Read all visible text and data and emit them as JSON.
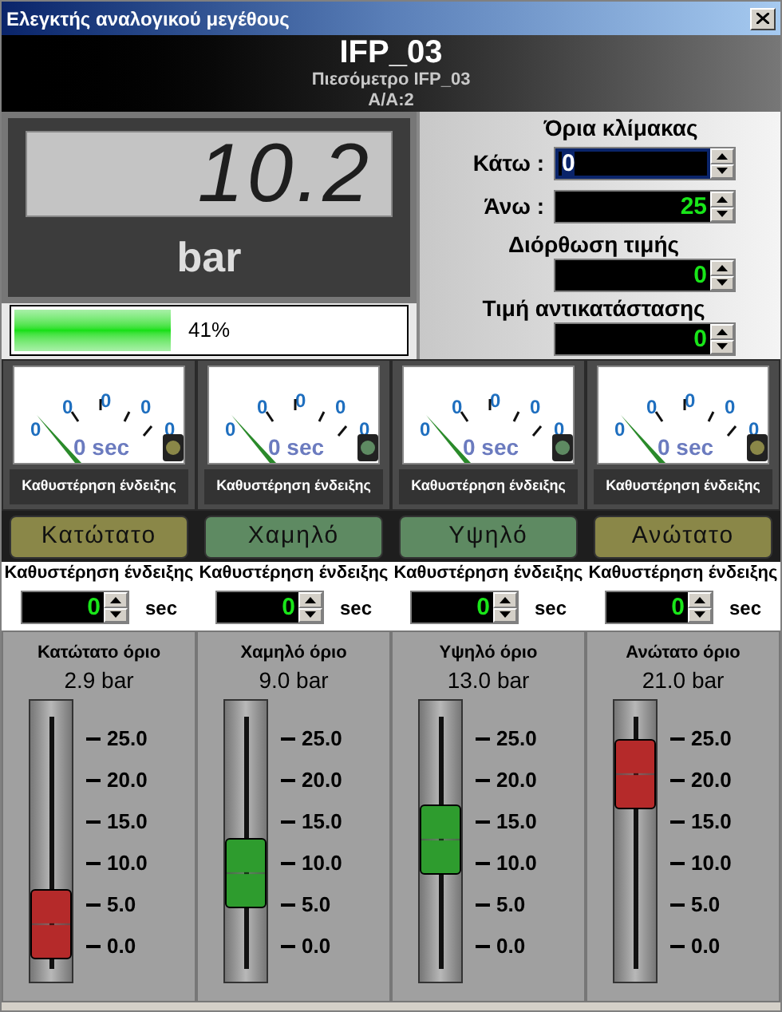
{
  "window": {
    "title": "Ελεγκτής αναλογικού μεγέθους"
  },
  "header": {
    "tag": "IFP_03",
    "description": "Πιεσόμετρο IFP_03",
    "index": "A/A:2"
  },
  "display": {
    "value": "10.2",
    "unit": "bar"
  },
  "progress": {
    "level": 0.41,
    "reading": "41%"
  },
  "scale": {
    "title": "Όρια κλίμακας",
    "fields": [
      {
        "kind": "inline",
        "label": "Κάτω :",
        "value": "0",
        "focused": true
      },
      {
        "kind": "inline",
        "label": "Άνω :",
        "value": "25",
        "focused": false
      },
      {
        "kind": "titled",
        "label": "Διόρθωση τιμής",
        "value": "0",
        "focused": false
      },
      {
        "kind": "titled",
        "label": "Τιμή αντικατάστασης",
        "value": "0",
        "focused": false
      }
    ]
  },
  "channels": [
    {
      "gauge": {
        "labels": [
          "0",
          "0",
          "0",
          "0",
          "0"
        ],
        "reading": "0 sec",
        "caption": "Καθυστέρηση ένδειξης"
      },
      "alarm": {
        "label": "Κατώτατο",
        "color": "#8a8748"
      },
      "delay": {
        "label": "Καθυστέρηση ένδειξης",
        "value": "0",
        "unit": "sec"
      },
      "limit": {
        "title": "Κατώτατο όριο",
        "reading": "2.9 bar",
        "level": 0.116,
        "color": "#b52a2a",
        "ticks": [
          "25.0",
          "20.0",
          "15.0",
          "10.0",
          "5.0",
          "0.0"
        ]
      }
    },
    {
      "gauge": {
        "labels": [
          "0",
          "0",
          "0",
          "0",
          "0"
        ],
        "reading": "0 sec",
        "caption": "Καθυστέρηση ένδειξης"
      },
      "alarm": {
        "label": "Χαμηλό",
        "color": "#5e8a62"
      },
      "delay": {
        "label": "Καθυστέρηση ένδειξης",
        "value": "0",
        "unit": "sec"
      },
      "limit": {
        "title": "Χαμηλό όριο",
        "reading": "9.0 bar",
        "level": 0.36,
        "color": "#2e9c2e",
        "ticks": [
          "25.0",
          "20.0",
          "15.0",
          "10.0",
          "5.0",
          "0.0"
        ]
      }
    },
    {
      "gauge": {
        "labels": [
          "0",
          "0",
          "0",
          "0",
          "0"
        ],
        "reading": "0 sec",
        "caption": "Καθυστέρηση ένδειξης"
      },
      "alarm": {
        "label": "Υψηλό",
        "color": "#5e8a62"
      },
      "delay": {
        "label": "Καθυστέρηση ένδειξης",
        "value": "0",
        "unit": "sec"
      },
      "limit": {
        "title": "Υψηλό όριο",
        "reading": "13.0 bar",
        "level": 0.52,
        "color": "#2e9c2e",
        "ticks": [
          "25.0",
          "20.0",
          "15.0",
          "10.0",
          "5.0",
          "0.0"
        ]
      }
    },
    {
      "gauge": {
        "labels": [
          "0",
          "0",
          "0",
          "0",
          "0"
        ],
        "reading": "0 sec",
        "caption": "Καθυστέρηση ένδειξης"
      },
      "alarm": {
        "label": "Ανώτατο",
        "color": "#8a8748"
      },
      "delay": {
        "label": "Καθυστέρηση ένδειξης",
        "value": "0",
        "unit": "sec"
      },
      "limit": {
        "title": "Ανώτατο όριο",
        "reading": "21.0 bar",
        "level": 0.84,
        "color": "#b52a2a",
        "ticks": [
          "25.0",
          "20.0",
          "15.0",
          "10.0",
          "5.0",
          "0.0"
        ]
      }
    }
  ]
}
